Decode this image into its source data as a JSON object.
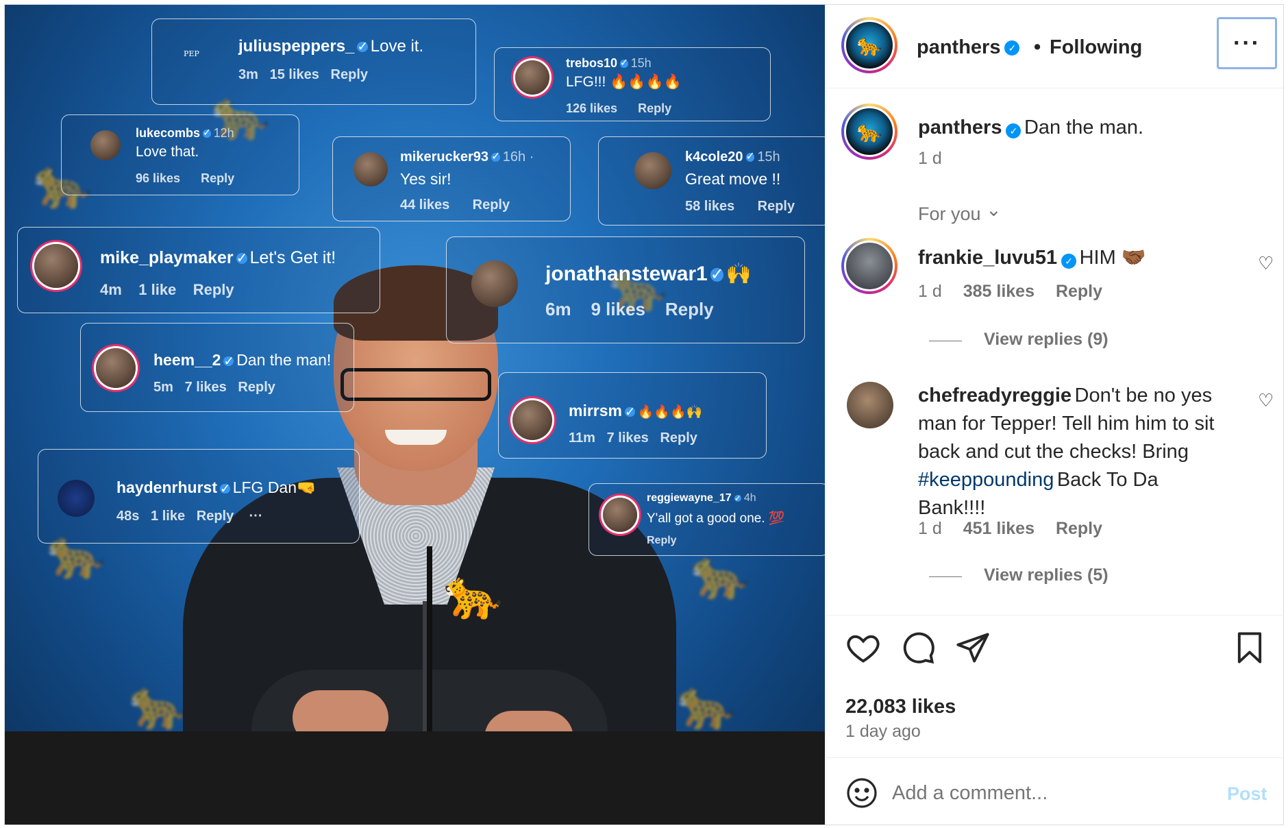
{
  "photo": {
    "bubbles": [
      {
        "user": "juliuspeppers_",
        "text": "Love it.",
        "time": "3m",
        "likes": "15 likes",
        "reply": "Reply",
        "avatar_label": "PEP"
      },
      {
        "user": "trebos10",
        "time": "15h",
        "text": "LFG!!! 🔥🔥🔥🔥",
        "likes": "126 likes",
        "reply": "Reply"
      },
      {
        "user": "lukecombs",
        "time": "12h",
        "text": "Love that.",
        "likes": "96 likes",
        "reply": "Reply"
      },
      {
        "user": "mikerucker93",
        "time": "16h ·",
        "text": "Yes sir!",
        "likes": "44 likes",
        "reply": "Reply"
      },
      {
        "user": "k4cole20",
        "time": "15h",
        "text": "Great move !!",
        "likes": "58 likes",
        "reply": "Reply"
      },
      {
        "user": "mike_playmaker",
        "text": "Let's Get it!",
        "time": "4m",
        "likes": "1 like",
        "reply": "Reply"
      },
      {
        "user": "jonathanstewar1",
        "text": "🙌",
        "time": "6m",
        "likes": "9 likes",
        "reply": "Reply"
      },
      {
        "user": "heem__2",
        "text": "Dan the man!",
        "time": "5m",
        "likes": "7 likes",
        "reply": "Reply"
      },
      {
        "user": "mirrsm",
        "text": "🔥🔥🔥🙌",
        "time": "11m",
        "likes": "7 likes",
        "reply": "Reply"
      },
      {
        "user": "haydenrhurst",
        "text": "LFG Dan🤜",
        "time": "48s",
        "likes": "1 like",
        "reply": "Reply",
        "more": "···"
      },
      {
        "user": "reggiewayne_17",
        "time": "4h",
        "text": "Y'all got a good one. 💯",
        "reply": "Reply"
      }
    ]
  },
  "header": {
    "username": "panthers",
    "dot": "•",
    "follow_status": "Following",
    "more_label": "···"
  },
  "caption": {
    "username": "panthers",
    "text": "Dan the man.",
    "time": "1 d"
  },
  "sort": {
    "label": "For you",
    "chevron": "⌄"
  },
  "comments": [
    {
      "username": "frankie_luvu51",
      "text": "HIM 🤝🏾",
      "time": "1 d",
      "likes": "385 likes",
      "reply": "Reply",
      "view_replies": "View replies (9)"
    },
    {
      "username": "chefreadyreggie",
      "text_line1": "Don't be no yes",
      "text_line2": "man for Tepper! Tell him him to sit",
      "text_line3": "back and cut the checks! Bring",
      "hashtag": "#keeppounding",
      "text_line4_rest": "Back To Da",
      "text_line5": "Bank!!!!",
      "time": "1 d",
      "likes": "451 likes",
      "reply": "Reply",
      "view_replies": "View replies (5)"
    }
  ],
  "footer": {
    "likes": "22,083 likes",
    "time_ago": "1 day ago",
    "comment_placeholder": "Add a comment...",
    "post_label": "Post"
  },
  "icons": {
    "like": "heart-icon",
    "comment": "comment-icon",
    "share": "share-icon",
    "save": "bookmark-icon",
    "emoji": "emoji-icon"
  },
  "colors": {
    "verified": "#0095f6",
    "post_disabled": "#b2dffc",
    "hashtag": "#00376b",
    "more_button_focus": "#8fb2e8"
  }
}
